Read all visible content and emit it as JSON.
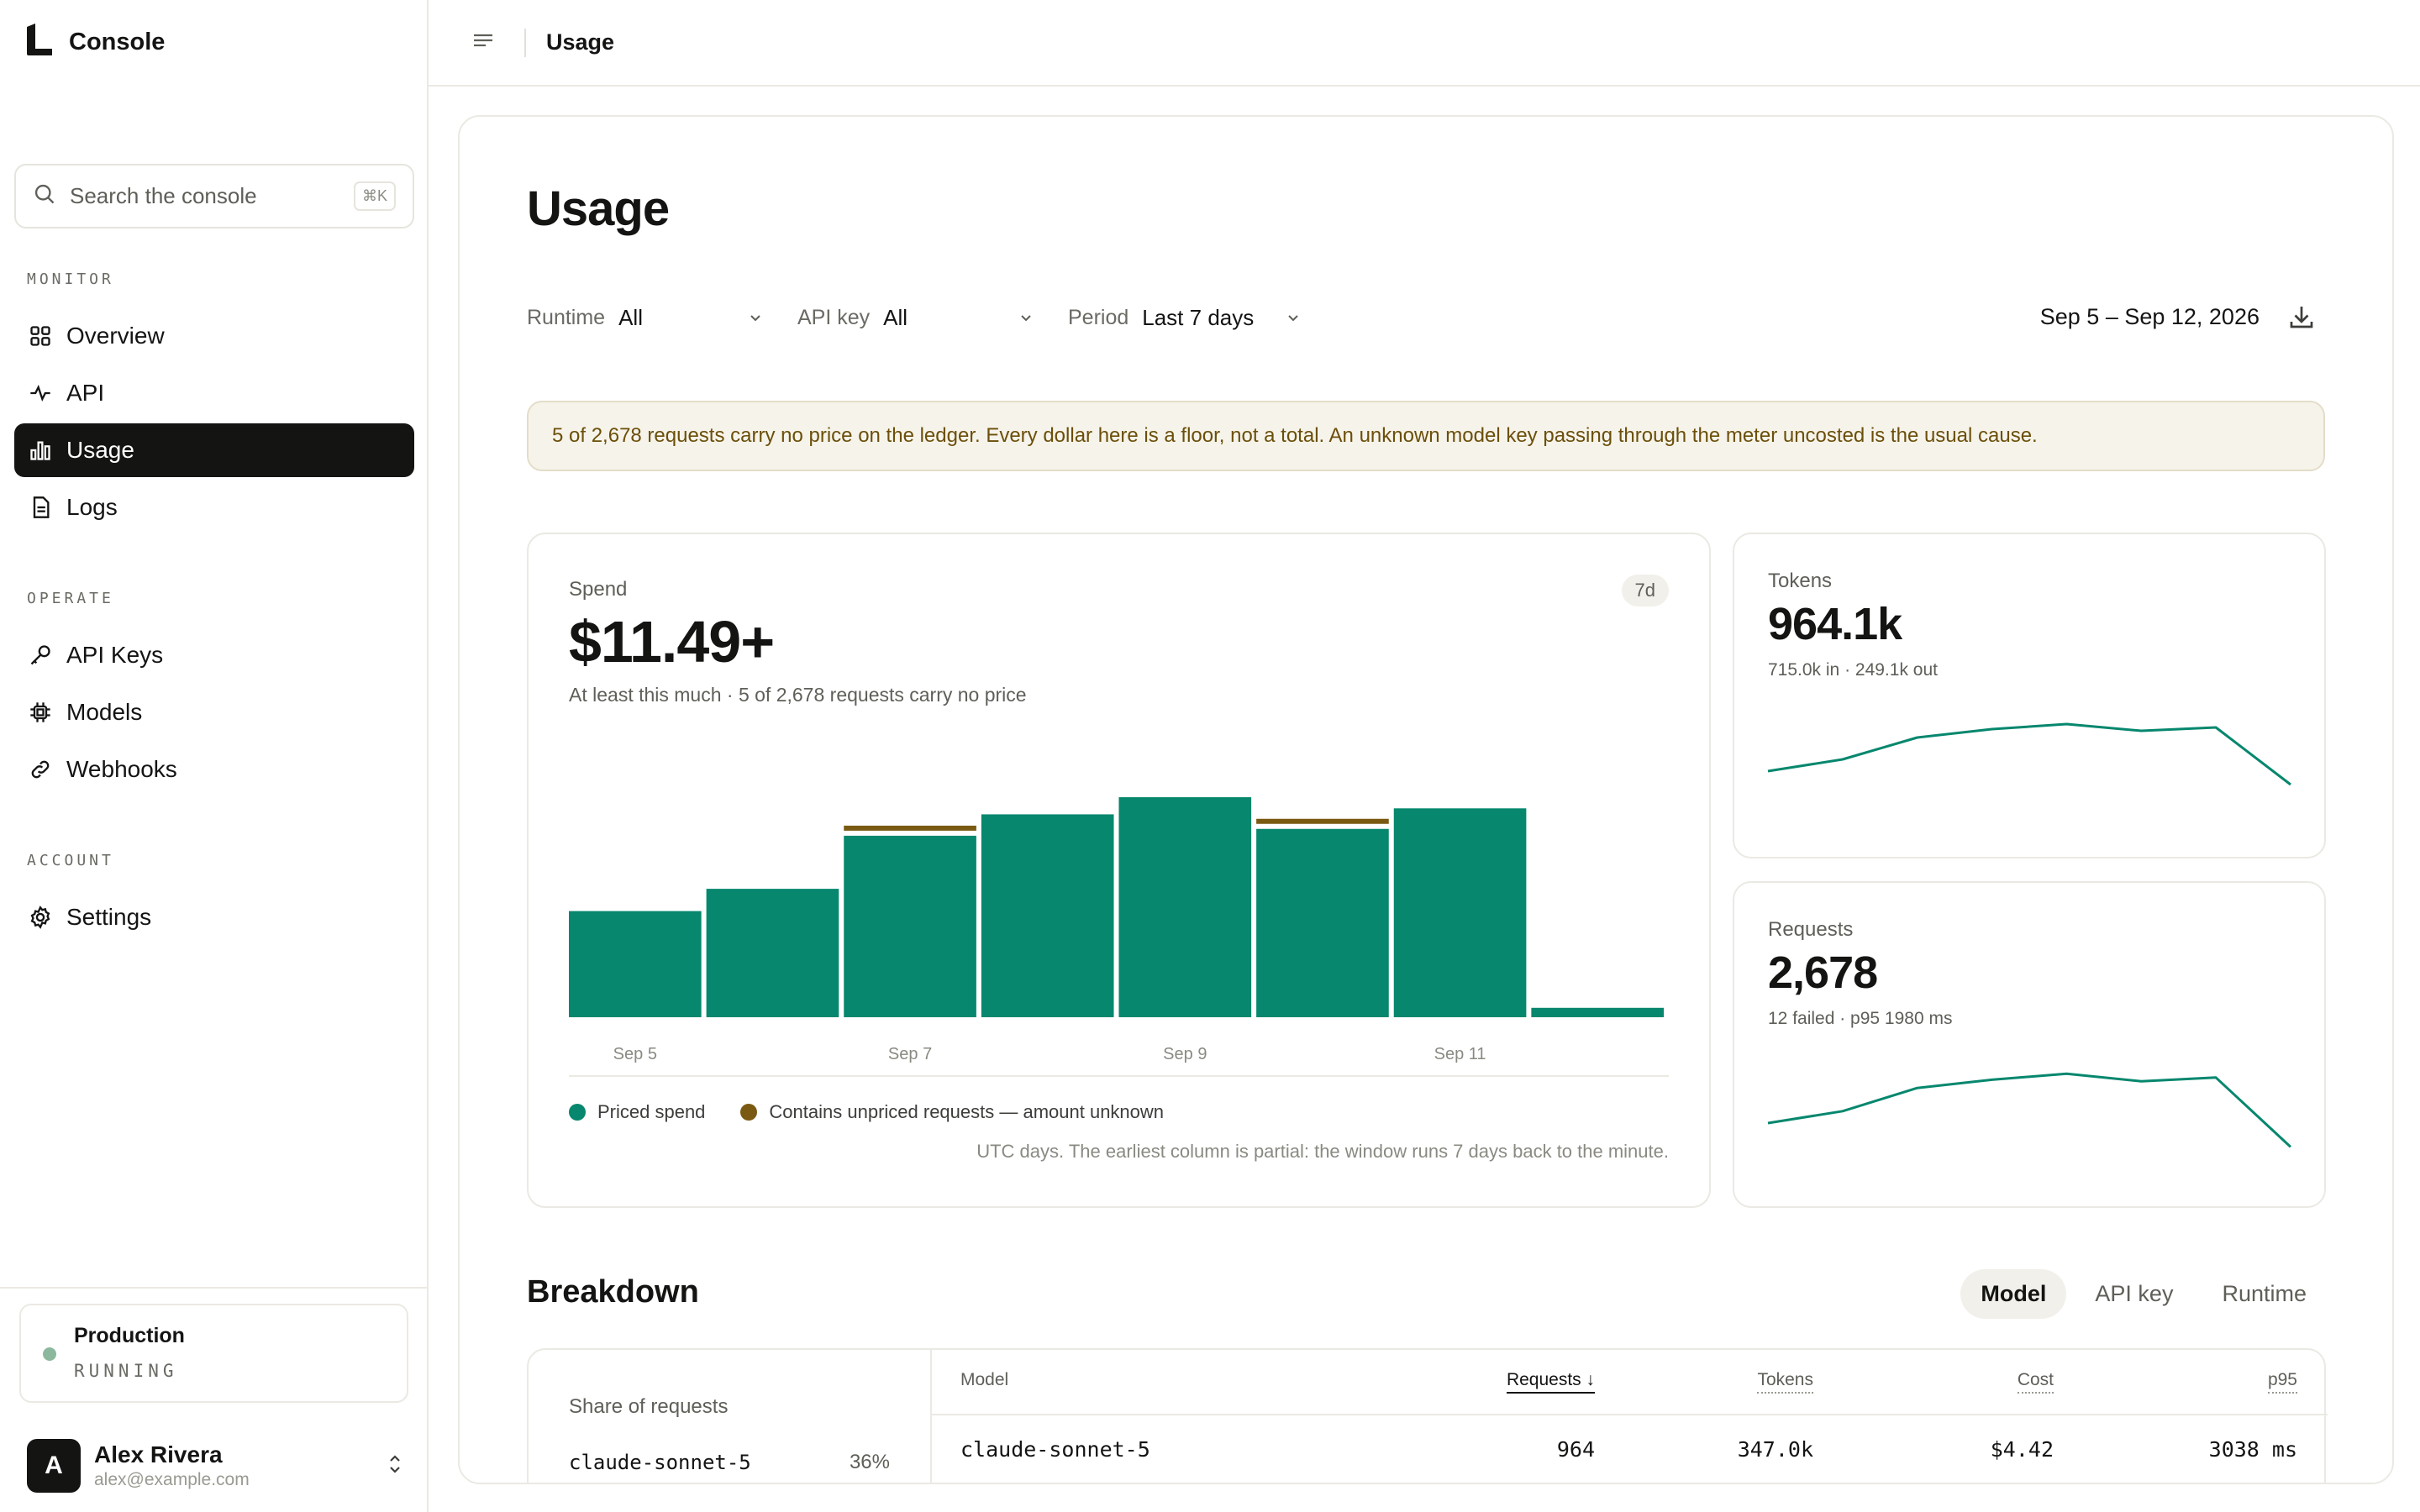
{
  "app": {
    "brand": "Console"
  },
  "sidebar": {
    "search_placeholder": "Search the console",
    "search_shortcut": "⌘K",
    "sections": {
      "monitor": "MONITOR",
      "operate": "OPERATE",
      "account": "ACCOUNT"
    },
    "items": {
      "overview": "Overview",
      "api": "API",
      "usage": "Usage",
      "logs": "Logs",
      "api_keys": "API Keys",
      "models": "Models",
      "webhooks": "Webhooks",
      "settings": "Settings"
    },
    "environment": {
      "name": "Production",
      "status": "RUNNING",
      "status_color": "#8cb89e"
    },
    "user": {
      "initial": "A",
      "name": "Alex Rivera",
      "email": "alex@example.com"
    }
  },
  "topbar": {
    "title": "Usage"
  },
  "page": {
    "title": "Usage",
    "filters": {
      "runtime": {
        "label": "Runtime",
        "value": "All"
      },
      "api_key": {
        "label": "API key",
        "value": "All"
      },
      "period": {
        "label": "Period",
        "value": "Last 7 days"
      }
    },
    "date_range": "Sep 5 – Sep 12, 2026",
    "notice": "5 of 2,678 requests carry no price on the ledger. Every dollar here is a floor, not a total. An unknown model key passing through the meter uncosted is the usual cause."
  },
  "spend": {
    "label": "Spend",
    "badge": "7d",
    "value": "$11.49+",
    "subtitle": "At least this much · 5 of 2,678 requests carry no price",
    "legend_priced": "Priced spend",
    "legend_unpriced": "Contains unpriced requests — amount unknown",
    "note": "UTC days. The earliest column is partial: the window runs 7 days back to the minute."
  },
  "tokens": {
    "label": "Tokens",
    "value": "964.1k",
    "subtitle": "715.0k in · 249.1k out"
  },
  "requests": {
    "label": "Requests",
    "value": "2,678",
    "subtitle": "12 failed · p95 1980 ms"
  },
  "breakdown": {
    "title": "Breakdown",
    "tabs": {
      "model": "Model",
      "api_key": "API key",
      "runtime": "Runtime"
    },
    "share_title": "Share of requests",
    "share": [
      {
        "name": "claude-sonnet-5",
        "pct": "36%"
      }
    ],
    "columns": {
      "model": "Model",
      "requests": "Requests ↓",
      "tokens": "Tokens",
      "cost": "Cost",
      "p95": "p95"
    },
    "rows": [
      {
        "model": "claude-sonnet-5",
        "requests": "964",
        "tokens": "347.0k",
        "cost": "$4.42",
        "p95": "3038 ms"
      }
    ]
  },
  "colors": {
    "accent": "#06876e",
    "unpriced": "#7a5a12",
    "active_nav": "#141413"
  },
  "chart_data": [
    {
      "type": "bar",
      "title": "Spend",
      "categories": [
        "Sep 5",
        "Sep 6",
        "Sep 7",
        "Sep 8",
        "Sep 9",
        "Sep 10",
        "Sep 11",
        "Sep 12"
      ],
      "tick_labels": [
        "Sep 5",
        "Sep 7",
        "Sep 9",
        "Sep 11"
      ],
      "series": [
        {
          "name": "Priced spend",
          "values": [
            1.24,
            1.5,
            2.12,
            2.37,
            2.57,
            2.2,
            2.44,
            0.11
          ]
        }
      ],
      "unpriced_flags": [
        false,
        false,
        true,
        false,
        false,
        true,
        false,
        false
      ],
      "ylim": [
        0,
        2.6
      ]
    },
    {
      "type": "line",
      "title": "Tokens",
      "x": [
        "Sep 5",
        "Sep 6",
        "Sep 7",
        "Sep 8",
        "Sep 9",
        "Sep 10",
        "Sep 11",
        "Sep 12"
      ],
      "values": [
        134,
        141,
        154,
        159,
        162,
        158,
        160,
        126
      ],
      "ylim": [
        100,
        180
      ]
    },
    {
      "type": "line",
      "title": "Requests",
      "x": [
        "Sep 5",
        "Sep 6",
        "Sep 7",
        "Sep 8",
        "Sep 9",
        "Sep 10",
        "Sep 11",
        "Sep 12"
      ],
      "values": [
        372,
        388,
        419,
        430,
        438,
        428,
        433,
        340
      ],
      "ylim": [
        300,
        480
      ]
    }
  ]
}
